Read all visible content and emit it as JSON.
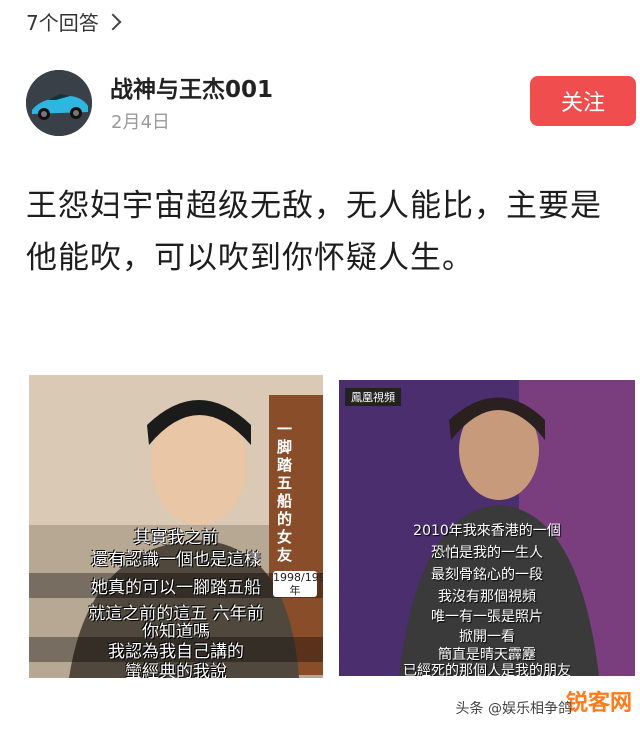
{
  "header": {
    "answer_count": "7个回答"
  },
  "author": {
    "name": "战神与王杰001",
    "date": "2月4日",
    "follow_label": "关注"
  },
  "post": {
    "text": "王怨妇宇宙超级无敌，无人能比，主要是他能吹，可以吹到你怀疑人生。"
  },
  "image_left": {
    "side_text": "一脚踏五船的女友",
    "year_badge": "1998/1999年",
    "subtitles": [
      "其實我之前",
      "還有認識一個也是這樣",
      "她真的可以一腳踏五船",
      "就這之前的這五 六年前",
      "你知道嗎",
      "我認為我自己講的",
      "蠻經典的我說"
    ]
  },
  "image_right": {
    "channel_label": "鳳凰視頻",
    "subtitles": [
      "2010年我來香港的一個",
      "恐怕是我的一生人",
      "最刻骨銘心的一段",
      "我沒有那個視頻",
      "唯一有一張是照片",
      "掀開一看",
      "簡直是晴天霹靂",
      "已經死的那個人是我的朋友"
    ]
  },
  "watermark": {
    "logo": "锐客网",
    "source": "头条 @娱乐相争鸽"
  },
  "colors": {
    "follow_bg": "#f04d4e",
    "text_main": "#1d1d1d",
    "text_muted": "#9a9a9a"
  }
}
